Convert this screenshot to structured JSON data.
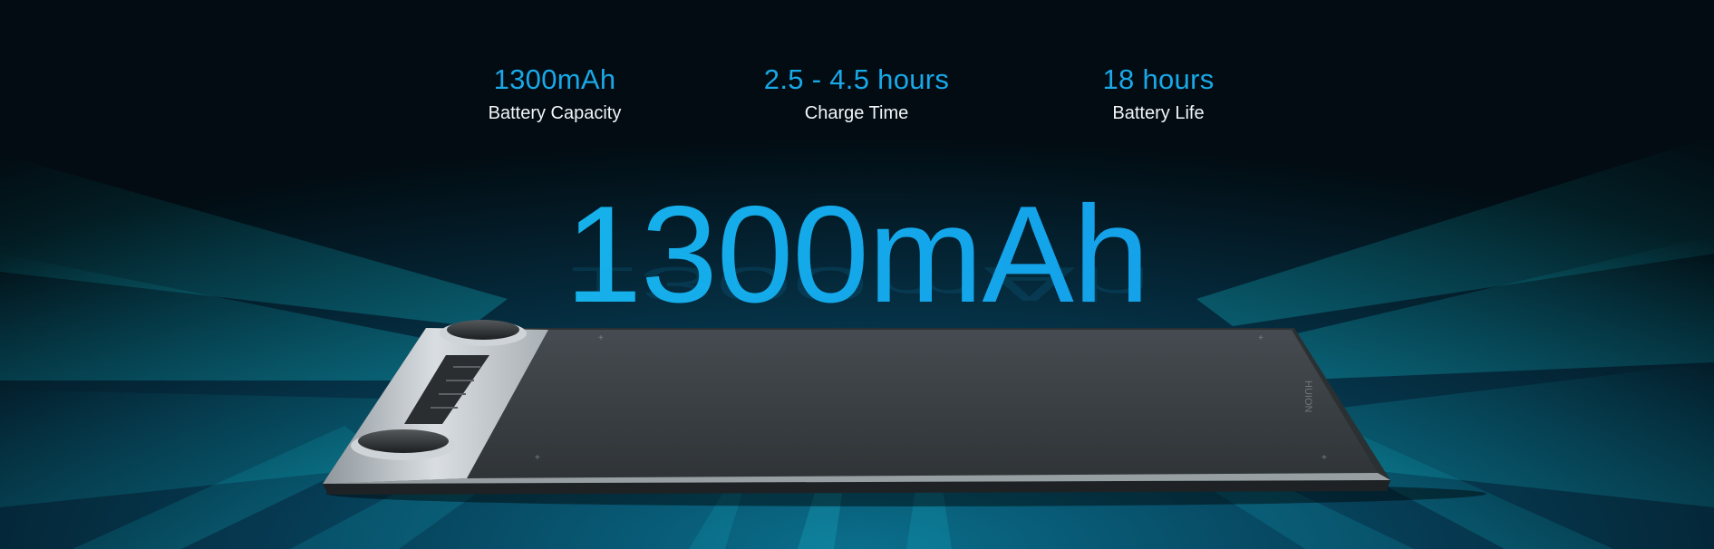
{
  "stats": [
    {
      "value": "1300mAh",
      "label": "Battery Capacity"
    },
    {
      "value": "2.5 - 4.5 hours",
      "label": "Charge Time"
    },
    {
      "value": "18 hours",
      "label": "Battery Life"
    }
  ],
  "hero": {
    "value": "1300mAh"
  },
  "device": {
    "brand": "HUION"
  },
  "colors": {
    "accent": "#19a8e8",
    "background": "#031018",
    "tablet_surface": "#3a3f43",
    "tablet_frame": "#b9c0c5"
  }
}
